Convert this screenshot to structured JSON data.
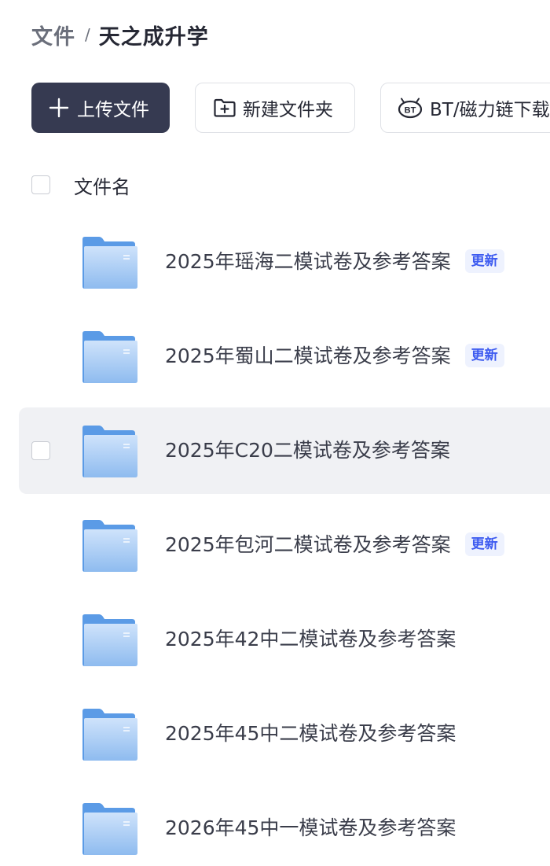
{
  "breadcrumb": {
    "root": "文件",
    "separator": "/",
    "current": "天之成升学"
  },
  "toolbar": {
    "upload_label": "上传文件",
    "new_folder_label": "新建文件夹",
    "bt_label": "BT/磁力链下载"
  },
  "list": {
    "header_label": "文件名",
    "files": [
      {
        "name": "2025年瑶海二模试卷及参考答案",
        "badge": "更新"
      },
      {
        "name": "2025年蜀山二模试卷及参考答案",
        "badge": "更新"
      },
      {
        "name": "2025年C20二模试卷及参考答案",
        "badge": ""
      },
      {
        "name": "2025年包河二模试卷及参考答案",
        "badge": "更新"
      },
      {
        "name": "2025年42中二模试卷及参考答案",
        "badge": ""
      },
      {
        "name": "2025年45中二模试卷及参考答案",
        "badge": ""
      },
      {
        "name": "2026年45中一模试卷及参考答案",
        "badge": ""
      }
    ]
  },
  "icons": {
    "upload": "plus-icon",
    "new_folder": "folder-plus-icon",
    "bt": "bt-icon",
    "file": "folder-icon"
  },
  "colors": {
    "primary_button": "#363a51",
    "badge_text": "#3d5bf0",
    "badge_bg": "#eef2fe",
    "row_hover": "#f0f1f4"
  }
}
